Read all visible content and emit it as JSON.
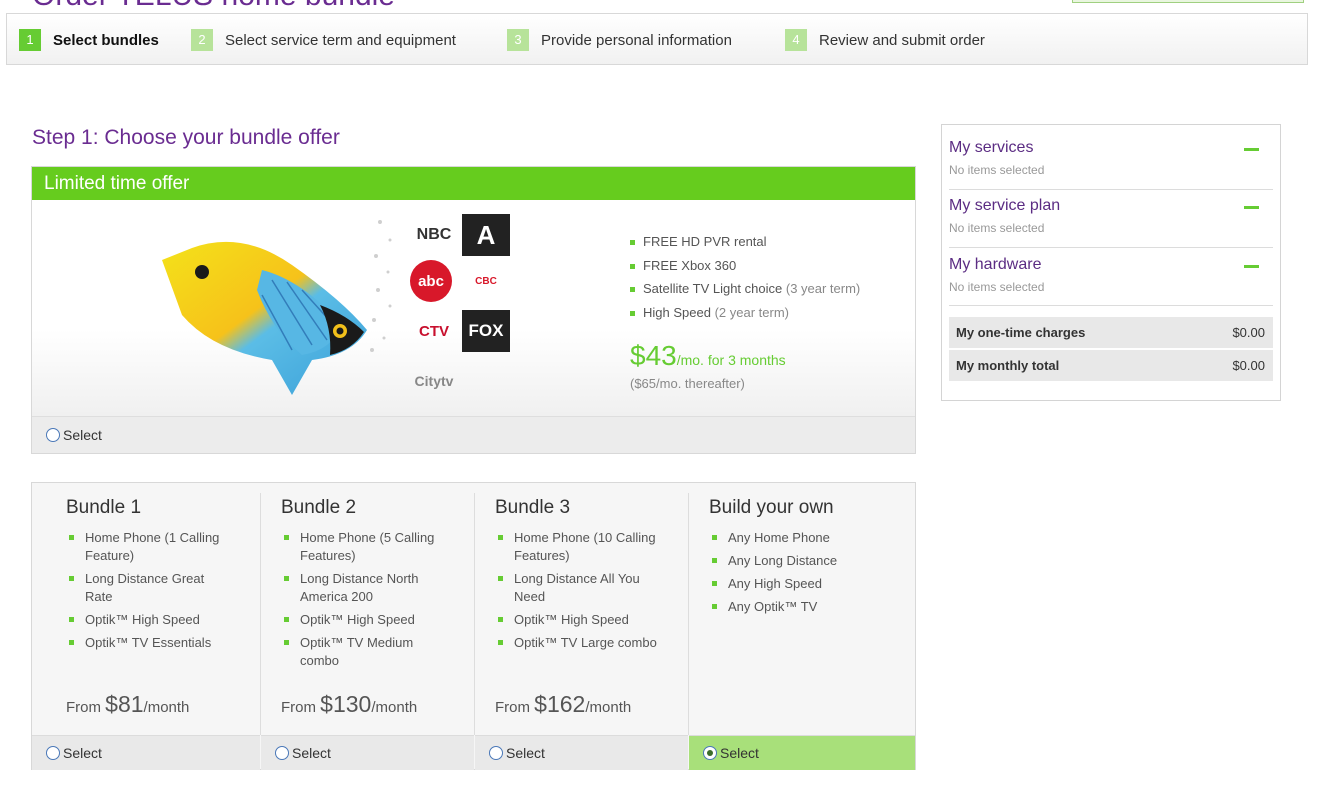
{
  "header": {
    "title": "Order TELUS home bundle"
  },
  "steps": [
    {
      "num": "1",
      "label": "Select bundles"
    },
    {
      "num": "2",
      "label": "Select service term and equipment"
    },
    {
      "num": "3",
      "label": "Provide personal information"
    },
    {
      "num": "4",
      "label": "Review and submit order"
    }
  ],
  "main": {
    "heading": "Step 1: Choose your bundle offer",
    "offer": {
      "banner": "Limited time offer",
      "features": [
        {
          "text": "FREE HD PVR rental",
          "note": ""
        },
        {
          "text": "FREE Xbox 360",
          "note": ""
        },
        {
          "text": "Satellite TV Light choice",
          "note": "(3 year term)"
        },
        {
          "text": "High Speed",
          "note": "(2 year term)"
        }
      ],
      "price": "$43",
      "price_unit": "/mo. for 3 months",
      "price_after": "($65/mo. thereafter)",
      "select_label": "Select",
      "logos": [
        "NBC",
        "A",
        "abc",
        "CBC",
        "CTV",
        "FOX",
        "Citytv"
      ]
    },
    "bundles": [
      {
        "name": "Bundle 1",
        "items": [
          "Home Phone (1 Calling Feature)",
          "Long Distance Great Rate",
          "Optik™ High Speed",
          "Optik™ TV Essentials"
        ],
        "from_label": "From",
        "price": "$81",
        "per": "/month",
        "select_label": "Select",
        "selected": false
      },
      {
        "name": "Bundle 2",
        "items": [
          "Home Phone (5 Calling Features)",
          "Long Distance North America 200",
          "Optik™ High Speed",
          "Optik™ TV Medium combo"
        ],
        "from_label": "From",
        "price": "$130",
        "per": "/month",
        "select_label": "Select",
        "selected": false
      },
      {
        "name": "Bundle 3",
        "items": [
          "Home Phone (10 Calling Features)",
          "Long Distance All You Need",
          "Optik™ High Speed",
          "Optik™ TV Large combo"
        ],
        "from_label": "From",
        "price": "$162",
        "per": "/month",
        "select_label": "Select",
        "selected": false
      },
      {
        "name": "Build your own",
        "items": [
          "Any Home Phone",
          "Any Long Distance",
          "Any High Speed",
          "Any Optik™ TV"
        ],
        "from_label": "",
        "price": "",
        "per": "",
        "select_label": "Select",
        "selected": true
      }
    ]
  },
  "sidebar": {
    "sections": [
      {
        "title": "My services",
        "status": "No items selected"
      },
      {
        "title": "My service plan",
        "status": "No items selected"
      },
      {
        "title": "My hardware",
        "status": "No items selected"
      }
    ],
    "totals": [
      {
        "label": "My one-time charges",
        "value": "$0.00"
      },
      {
        "label": "My monthly total",
        "value": "$0.00"
      }
    ]
  },
  "colors": {
    "accent_green": "#66cc33",
    "brand_purple": "#6a2c91",
    "selected_bg": "#a8e07a"
  }
}
